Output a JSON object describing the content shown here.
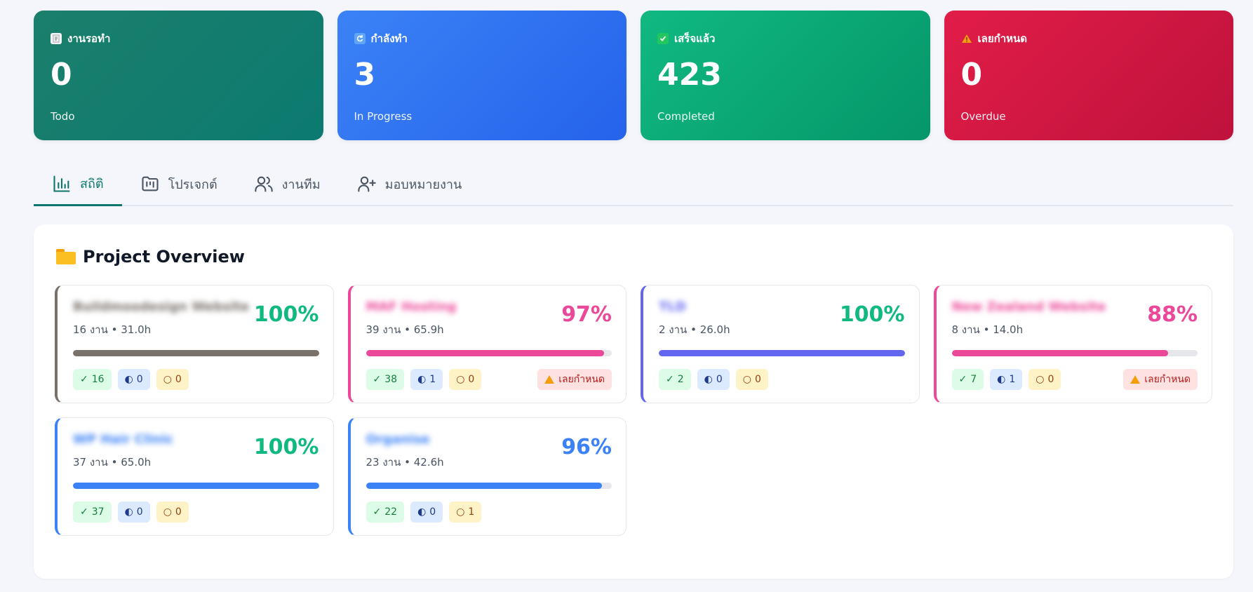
{
  "stats": [
    {
      "title": "งานรอทำ",
      "value": "0",
      "sub": "Todo",
      "icon": "memo-icon",
      "gradient_from": "#1b7f6c",
      "gradient_to": "#0c7a70"
    },
    {
      "title": "กำลังทำ",
      "value": "3",
      "sub": "In Progress",
      "icon": "refresh-icon",
      "gradient_from": "#3b82f6",
      "gradient_to": "#2563eb"
    },
    {
      "title": "เสร็จแล้ว",
      "value": "423",
      "sub": "Completed",
      "icon": "check-box-icon",
      "gradient_from": "#10b981",
      "gradient_to": "#059669"
    },
    {
      "title": "เลยกำหนด",
      "value": "0",
      "sub": "Overdue",
      "icon": "warning-icon",
      "gradient_from": "#e11d48",
      "gradient_to": "#be123c"
    }
  ],
  "tabs": [
    {
      "label": "สถิติ",
      "icon": "bar-chart-icon",
      "active": true
    },
    {
      "label": "โปรเจกต์",
      "icon": "folder-kanban-icon",
      "active": false
    },
    {
      "label": "งานทีม",
      "icon": "users-icon",
      "active": false
    },
    {
      "label": "มอบหมายงาน",
      "icon": "user-plus-icon",
      "active": false
    }
  ],
  "panel": {
    "title": "Project Overview",
    "icon": "folder-icon"
  },
  "projects": [
    {
      "name": "Buildmoodesign Website",
      "meta": "16 งาน • 31.0h",
      "percent": "100%",
      "progress": 1.0,
      "accent": "#78716c",
      "pct_color": "#10b981",
      "done": "16",
      "in_progress": "0",
      "todo": "0",
      "overdue": ""
    },
    {
      "name": "MAF Hosting",
      "meta": "39 งาน • 65.9h",
      "percent": "97%",
      "progress": 0.97,
      "accent": "#ec4899",
      "pct_color": "#ec4899",
      "done": "38",
      "in_progress": "1",
      "todo": "0",
      "overdue": "เลยกำหนด"
    },
    {
      "name": "TLD",
      "meta": "2 งาน • 26.0h",
      "percent": "100%",
      "progress": 1.0,
      "accent": "#6366f1",
      "pct_color": "#10b981",
      "done": "2",
      "in_progress": "0",
      "todo": "0",
      "overdue": ""
    },
    {
      "name": "New Zealand Website",
      "meta": "8 งาน • 14.0h",
      "percent": "88%",
      "progress": 0.88,
      "accent": "#ec4899",
      "pct_color": "#ec4899",
      "done": "7",
      "in_progress": "1",
      "todo": "0",
      "overdue": "เลยกำหนด"
    },
    {
      "name": "WP Hair Clinic",
      "meta": "37 งาน • 65.0h",
      "percent": "100%",
      "progress": 1.0,
      "accent": "#3b82f6",
      "pct_color": "#10b981",
      "done": "37",
      "in_progress": "0",
      "todo": "0",
      "overdue": ""
    },
    {
      "name": "Organise",
      "meta": "23 งาน • 42.6h",
      "percent": "96%",
      "progress": 0.96,
      "accent": "#3b82f6",
      "pct_color": "#3b82f6",
      "done": "22",
      "in_progress": "0",
      "todo": "1",
      "overdue": ""
    }
  ]
}
